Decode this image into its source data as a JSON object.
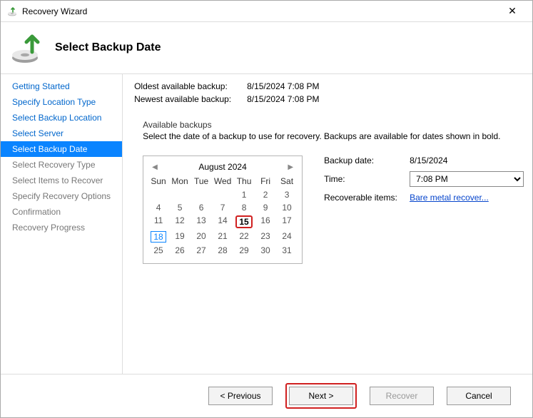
{
  "window": {
    "title": "Recovery Wizard"
  },
  "header": {
    "title": "Select Backup Date"
  },
  "sidebar": {
    "steps": [
      {
        "label": "Getting Started",
        "state": "link"
      },
      {
        "label": "Specify Location Type",
        "state": "link"
      },
      {
        "label": "Select Backup Location",
        "state": "link"
      },
      {
        "label": "Select Server",
        "state": "link"
      },
      {
        "label": "Select Backup Date",
        "state": "active"
      },
      {
        "label": "Select Recovery Type",
        "state": "disabled"
      },
      {
        "label": "Select Items to Recover",
        "state": "disabled"
      },
      {
        "label": "Specify Recovery Options",
        "state": "disabled"
      },
      {
        "label": "Confirmation",
        "state": "disabled"
      },
      {
        "label": "Recovery Progress",
        "state": "disabled"
      }
    ]
  },
  "info": {
    "oldest_label": "Oldest available backup:",
    "oldest_value": "8/15/2024 7:08 PM",
    "newest_label": "Newest available backup:",
    "newest_value": "8/15/2024 7:08 PM"
  },
  "available": {
    "legend": "Available backups",
    "desc": "Select the date of a backup to use for recovery. Backups are available for dates shown in bold."
  },
  "calendar": {
    "title": "August 2024",
    "dow": [
      "Sun",
      "Mon",
      "Tue",
      "Wed",
      "Thu",
      "Fri",
      "Sat"
    ],
    "weeks": [
      [
        "",
        "",
        "",
        "",
        "1",
        "2",
        "3"
      ],
      [
        "4",
        "5",
        "6",
        "7",
        "8",
        "9",
        "10"
      ],
      [
        "11",
        "12",
        "13",
        "14",
        "15",
        "16",
        "17"
      ],
      [
        "18",
        "19",
        "20",
        "21",
        "22",
        "23",
        "24"
      ],
      [
        "25",
        "26",
        "27",
        "28",
        "29",
        "30",
        "31"
      ]
    ],
    "selected": "15",
    "today": "18",
    "bold_days": [
      "15"
    ]
  },
  "details": {
    "backup_date_label": "Backup date:",
    "backup_date_value": "8/15/2024",
    "time_label": "Time:",
    "time_value": "7:08 PM",
    "recoverable_label": "Recoverable items:",
    "recoverable_link": "Bare metal recover..."
  },
  "footer": {
    "previous": "< Previous",
    "next": "Next >",
    "recover": "Recover",
    "cancel": "Cancel"
  }
}
